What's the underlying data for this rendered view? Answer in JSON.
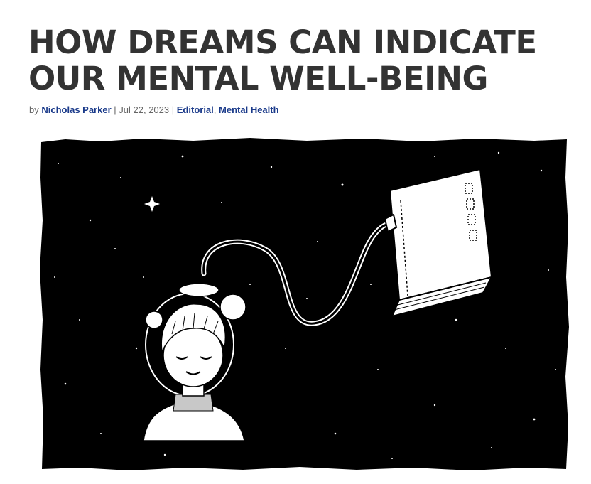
{
  "article": {
    "title_line1": "HOW DREAMS CAN INDICATE",
    "title_line2": "OUR MENTAL WELL-BEING",
    "meta": {
      "prefix": "by",
      "author": "Nicholas Parker",
      "sep1": "|",
      "date": "Jul 22, 2023",
      "sep2": "|",
      "category1": "Editorial",
      "comma": ",",
      "category2": "Mental Health"
    }
  },
  "illustration": {
    "subject": "boy-dreaming-connected-to-book",
    "colors": {
      "background": "#000000",
      "ink": "#ffffff"
    }
  }
}
